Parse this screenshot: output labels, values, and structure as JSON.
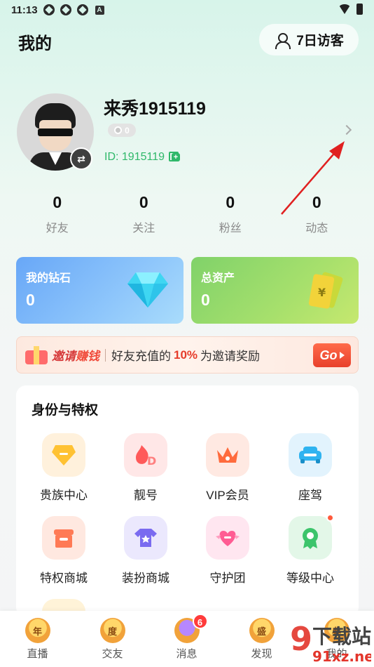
{
  "status": {
    "time": "11:13"
  },
  "header": {
    "title": "我的",
    "visitor_label": "7日访客"
  },
  "profile": {
    "username": "来秀1915119",
    "level_value": "0",
    "id_text": "ID: 1915119"
  },
  "stats": [
    {
      "value": "0",
      "label": "好友"
    },
    {
      "value": "0",
      "label": "关注"
    },
    {
      "value": "0",
      "label": "粉丝"
    },
    {
      "value": "0",
      "label": "动态"
    }
  ],
  "cards": {
    "diamond": {
      "title": "我的钻石",
      "value": "0"
    },
    "assets": {
      "title": "总资产",
      "value": "0"
    }
  },
  "banner": {
    "tag_a": "邀请",
    "tag_b": "赚钱",
    "text_a": "好友充值的",
    "percent": "10%",
    "text_b": "为邀请奖励",
    "go_label": "Go"
  },
  "privileges": {
    "title": "身份与特权",
    "items": [
      {
        "label": "贵族中心",
        "icon": "noble-icon"
      },
      {
        "label": "靓号",
        "icon": "pretty-id-icon"
      },
      {
        "label": "VIP会员",
        "icon": "vip-crown-icon"
      },
      {
        "label": "座驾",
        "icon": "car-icon"
      },
      {
        "label": "特权商城",
        "icon": "shop-icon"
      },
      {
        "label": "装扮商城",
        "icon": "dress-shop-icon"
      },
      {
        "label": "守护团",
        "icon": "guard-heart-icon"
      },
      {
        "label": "等级中心",
        "icon": "level-medal-icon"
      }
    ]
  },
  "nav": {
    "items": [
      {
        "label": "直播",
        "glyph": "年"
      },
      {
        "label": "交友",
        "glyph": "度"
      },
      {
        "label": "消息",
        "glyph": "",
        "badge": "6"
      },
      {
        "label": "发现",
        "glyph": "盛"
      },
      {
        "label": "我的",
        "glyph": "典"
      }
    ]
  },
  "watermark": {
    "line1": "下载站",
    "line2": "91xz.net",
    "digit": "9"
  },
  "colors": {
    "accent_green": "#2fb86a",
    "banner_red": "#e63c2a",
    "nav_badge": "#ff3b3b"
  }
}
